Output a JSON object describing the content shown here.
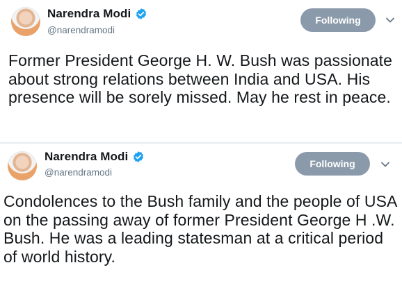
{
  "tweets": [
    {
      "name": "Narendra Modi",
      "handle": "@narendramodi",
      "follow_label": "Following",
      "text": "Former President George H. W. Bush was passionate about strong relations between India and USA. His presence will be sorely missed. May he rest in peace.",
      "icons": [
        "verified-badge-icon",
        "chevron-down-icon"
      ]
    },
    {
      "name": "Narendra Modi",
      "handle": "@narendramodi",
      "follow_label": "Following",
      "text": "Condolences to the Bush family and the people of USA on the passing away of former President George H .W. Bush. He was a leading statesman at a critical period of world history.",
      "icons": [
        "verified-badge-icon",
        "chevron-down-icon"
      ]
    }
  ],
  "colors": {
    "verified": "#1da1f2",
    "follow_button": "#8b9aaa",
    "text": "#14171a",
    "handle": "#657786"
  }
}
